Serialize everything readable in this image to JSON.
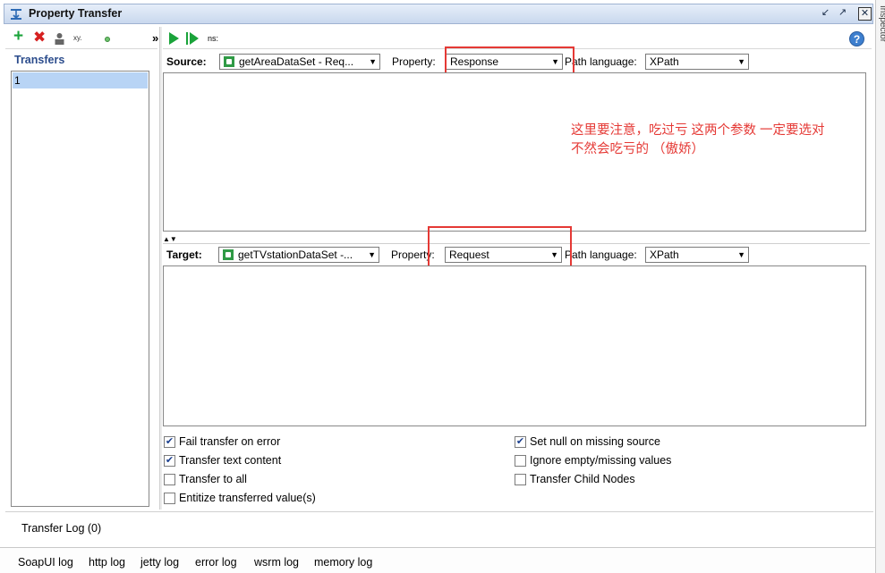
{
  "window": {
    "title": "Property Transfer",
    "side_edge_label": "Inspector"
  },
  "left_toolbar": {
    "add_icon": "plus-icon",
    "remove_icon": "red-x-icon",
    "rename_label": "xy.",
    "overflow_label": "»"
  },
  "transfers": {
    "header": "Transfers",
    "items": [
      "1"
    ]
  },
  "right_toolbar": {
    "run_icon": "play-icon",
    "run_to_icon": "play-step-icon",
    "ns_label": "ns:",
    "help_icon": "question-icon"
  },
  "source": {
    "label": "Source:",
    "step_value": "getAreaDataSet - Req...",
    "property_label": "Property:",
    "property_value": "Response",
    "path_language_label": "Path language:",
    "path_language_value": "XPath"
  },
  "target": {
    "label": "Target:",
    "step_value": "getTVstationDataSet -...",
    "property_label": "Property:",
    "property_value": "Request",
    "path_language_label": "Path language:",
    "path_language_value": "XPath"
  },
  "annotation": {
    "line1": "这里要注意，吃过亏 这两个参数 一定要选对",
    "line2": "不然会吃亏的 （傲娇）"
  },
  "options": [
    {
      "label": "Fail transfer on error",
      "checked": true
    },
    {
      "label": "Transfer text content",
      "checked": true
    },
    {
      "label": "Transfer to all",
      "checked": false
    },
    {
      "label": "Entitize transferred value(s)",
      "checked": false
    },
    {
      "label": "Set null on missing source",
      "checked": true
    },
    {
      "label": "Ignore empty/missing values",
      "checked": false
    },
    {
      "label": "Transfer Child Nodes",
      "checked": false
    }
  ],
  "transfer_log": {
    "label": "Transfer Log (0)"
  },
  "bottom_tabs": [
    "SoapUI log",
    "http log",
    "jetty log",
    "error log",
    "wsrm log",
    "memory log"
  ],
  "colors": {
    "accent_blue": "#2b4c8c",
    "annotation_red": "#e53935",
    "selection": "#b8d4f5",
    "run_green": "#1aa33a"
  }
}
